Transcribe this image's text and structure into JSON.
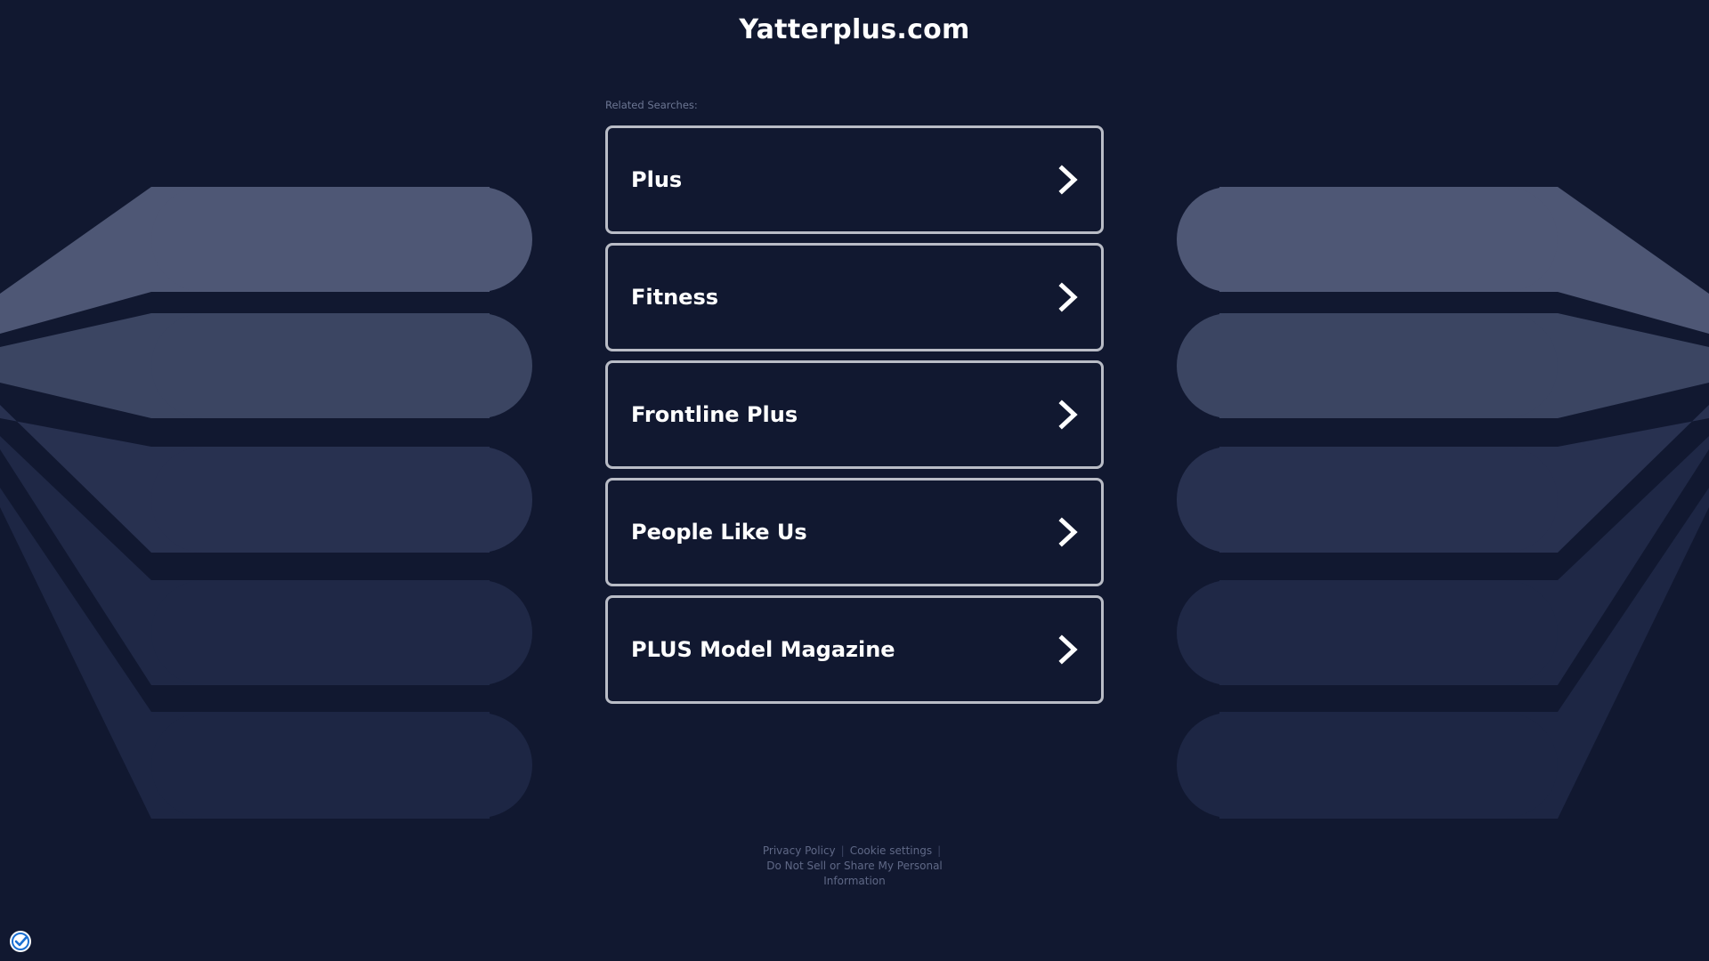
{
  "site": {
    "title": "Yatterplus.com"
  },
  "related": {
    "label": "Related Searches:",
    "items": [
      {
        "label": "Plus"
      },
      {
        "label": "Fitness"
      },
      {
        "label": "Frontline Plus"
      },
      {
        "label": "People Like Us"
      },
      {
        "label": "PLUS Model Magazine"
      }
    ]
  },
  "footer": {
    "privacy_policy": "Privacy Policy",
    "cookie_settings": "Cookie settings",
    "do_not_sell_line1": "Do Not Sell or Share My Personal",
    "do_not_sell_line2": "Information"
  },
  "icons": {
    "result_arrow": "chevron-right-icon",
    "privacy_badge": "shield-check-icon"
  },
  "colors": {
    "background": "#111830",
    "card_border": "#b9bcc6",
    "text": "#ffffff",
    "muted_text": "#6c7693",
    "band_1": "#4e5775",
    "band_2": "#3b4562",
    "band_3": "#283150",
    "band_4": "#1f2846",
    "band_5": "#1d2644"
  }
}
